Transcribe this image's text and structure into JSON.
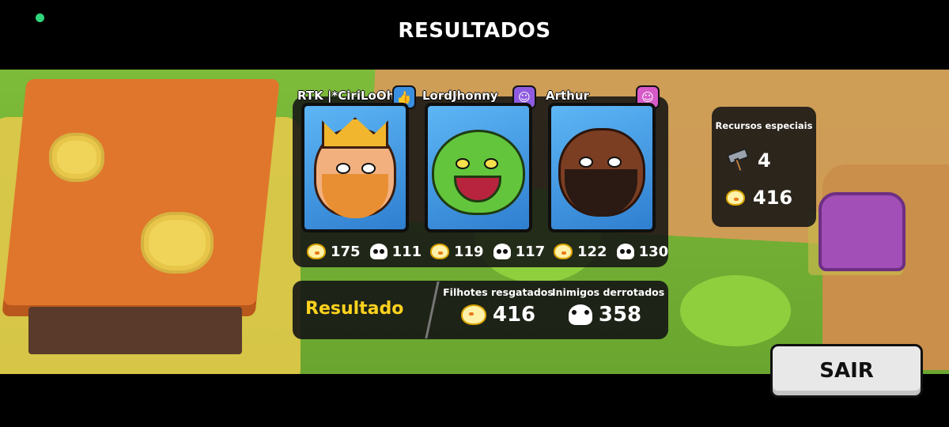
{
  "header": {
    "title": "RESULTADOS"
  },
  "players": [
    {
      "name": "RTK |*CiriLoOh*",
      "badge_icon": "thumbs-up-icon",
      "chicks": "175",
      "kills": "111"
    },
    {
      "name": "LordJhonny",
      "badge_icon": "avatar-icon",
      "chicks": "119",
      "kills": "117"
    },
    {
      "name": "Arthur",
      "badge_icon": "avatar-icon",
      "chicks": "122",
      "kills": "130"
    }
  ],
  "summary": {
    "label": "Resultado",
    "rescued_title": "Filhotes resgatados",
    "rescued_value": "416",
    "defeated_title": "Inimigos derrotados",
    "defeated_value": "358"
  },
  "special_resources": {
    "title": "Recursos especiais",
    "hammer_count": "4",
    "chick_count": "416"
  },
  "exit_button": {
    "label": "SAIR"
  },
  "colors": {
    "accent_yellow": "#ffd21e",
    "status_dot": "#2fd67b",
    "panel_bg": "#141414"
  }
}
